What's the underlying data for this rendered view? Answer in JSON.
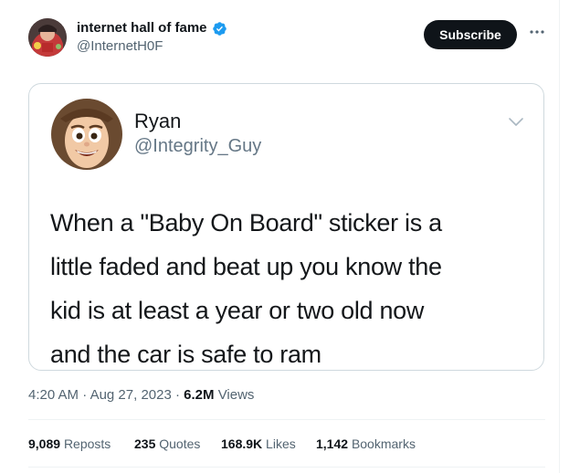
{
  "author": {
    "name": "internet hall of fame",
    "handle": "@InternetH0F",
    "verified": true,
    "avatar_icon": "avatar-photo"
  },
  "actions": {
    "subscribe_label": "Subscribe",
    "more_icon": "more-horizontal-icon"
  },
  "quoted": {
    "name": "Ryan",
    "handle": "@Integrity_Guy",
    "avatar_icon": "cartoon-cowboy-avatar",
    "text_lines": [
      "When a \"Baby On Board\" sticker  is a",
      "little faded and beat up you know the",
      "kid is at least a year or two old now",
      "and the car is safe to ram"
    ]
  },
  "meta": {
    "time": "4:20 AM",
    "separator": "·",
    "date": "Aug 27, 2023",
    "views_count": "6.2M",
    "views_label": "Views"
  },
  "stats": {
    "reposts": {
      "count": "9,089",
      "label": "Reposts"
    },
    "quotes": {
      "count": "235",
      "label": "Quotes"
    },
    "likes": {
      "count": "168.9K",
      "label": "Likes"
    },
    "bookmarks": {
      "count": "1,142",
      "label": "Bookmarks"
    }
  },
  "colors": {
    "verified": "#1d9bf0",
    "button_bg": "#0f1419",
    "secondary_text": "#536471",
    "border": "#cfd9de"
  }
}
